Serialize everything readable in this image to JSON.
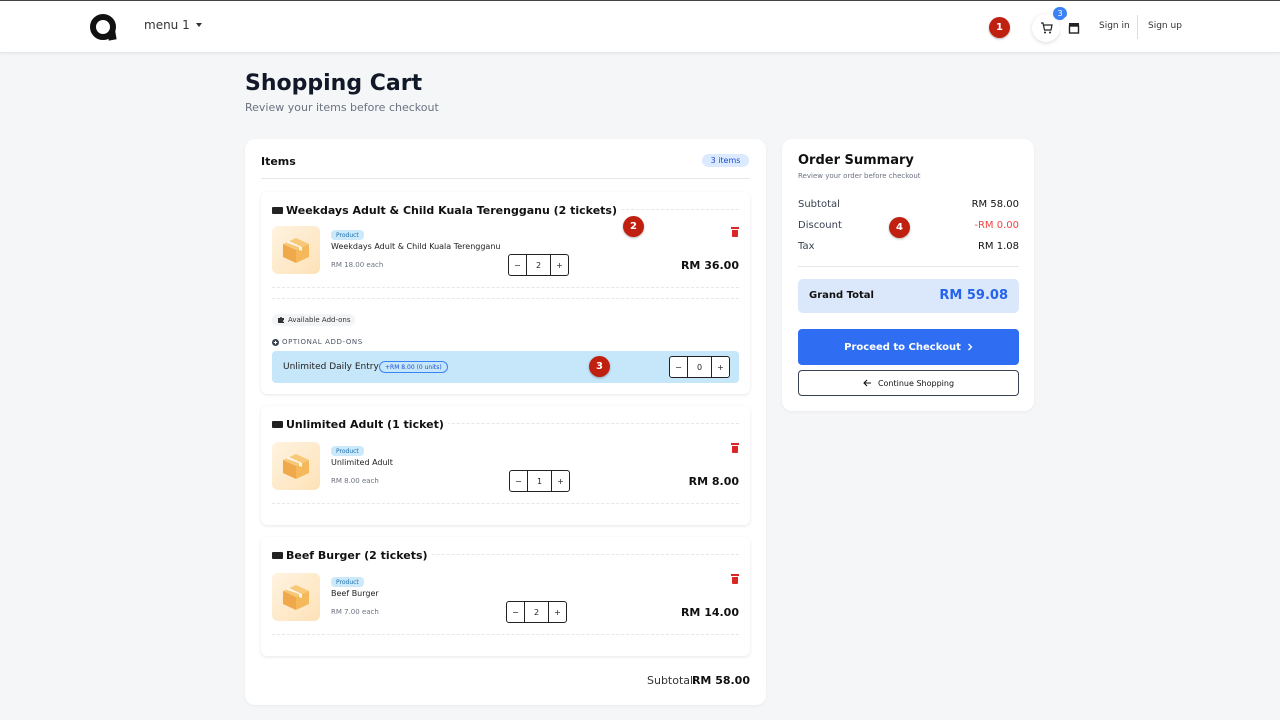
{
  "nav": {
    "logo": "Q",
    "menu_label": "menu 1",
    "cart_count": "3",
    "sign_in": "Sign in",
    "sign_up": "Sign up",
    "markers": [
      "1",
      "2",
      "3",
      "4"
    ]
  },
  "page": {
    "title": "Shopping Cart",
    "subtitle": "Review your items before checkout"
  },
  "cart": {
    "header": "Items",
    "count_badge": "3 items",
    "groups": [
      {
        "title": "Weekdays Adult & Child Kuala Terengganu (2 tickets)",
        "badge": "Product",
        "name": "Weekdays Adult & Child Kuala Terengganu",
        "each": "RM 18.00 each",
        "qty": "2",
        "total": "RM 36.00",
        "addons_label": "Available Add-ons",
        "optional_label": "OPTIONAL ADD-ONS",
        "addon": {
          "name": "Unlimited Daily Entry",
          "price": "+RM 8.00 (0 units)",
          "qty": "0"
        }
      },
      {
        "title": "Unlimited Adult (1 ticket)",
        "badge": "Product",
        "name": "Unlimited Adult",
        "each": "RM 8.00 each",
        "qty": "1",
        "total": "RM 8.00"
      },
      {
        "title": "Beef Burger (2 tickets)",
        "badge": "Product",
        "name": "Beef Burger",
        "each": "RM 7.00 each",
        "qty": "2",
        "total": "RM 14.00"
      }
    ],
    "stepper_minus": "−",
    "stepper_plus": "+",
    "subtotal_label": "Subtotal:",
    "subtotal_value": "RM 58.00"
  },
  "summary": {
    "title": "Order Summary",
    "subtitle": "Review your order before checkout",
    "subtotal_label": "Subtotal",
    "subtotal_value": "RM 58.00",
    "discount_label": "Discount",
    "discount_value": "-RM 0.00",
    "tax_label": "Tax",
    "tax_value": "RM 1.08",
    "grand_label": "Grand Total",
    "grand_value": "RM 59.08",
    "checkout_label": "Proceed to Checkout",
    "continue_label": "Continue Shopping"
  },
  "colors": {
    "primary": "#2f6ef3",
    "danger": "#ef4444",
    "marker": "#c0200f",
    "addon_bg": "#c6e6f9"
  },
  "icons": [
    "cart-icon",
    "store-icon",
    "ticket-icon",
    "box-icon",
    "trash-icon",
    "puzzle-icon",
    "chevron-right-icon",
    "arrow-left-icon"
  ]
}
